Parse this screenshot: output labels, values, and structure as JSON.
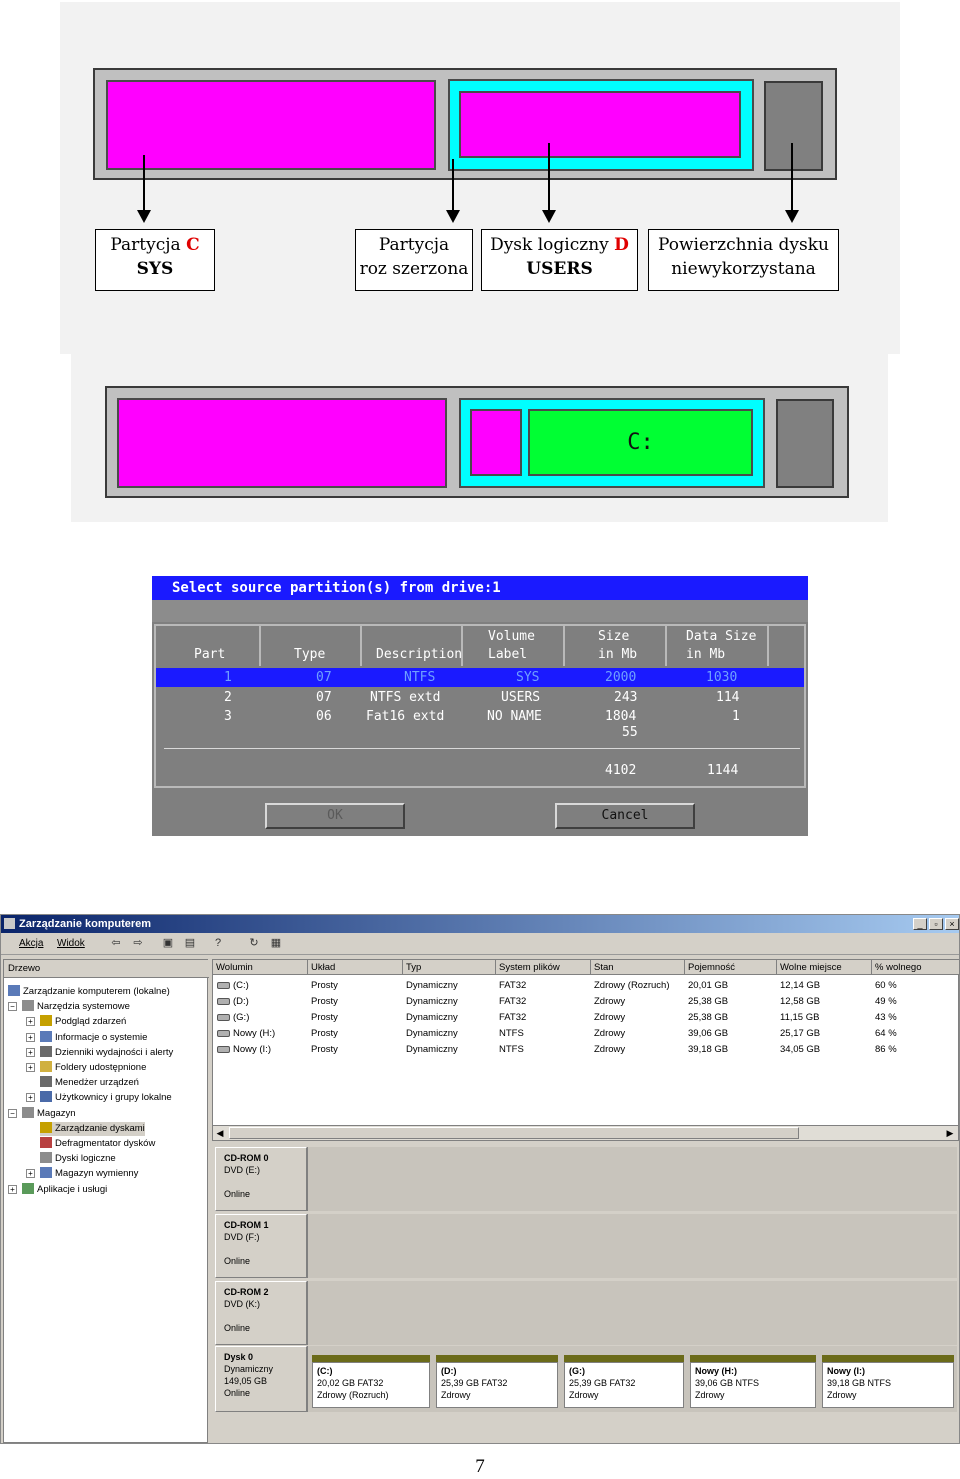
{
  "fig1": {
    "labels": [
      {
        "line1_text": "Partycja ",
        "line1_letter": "C",
        "line2": "SYS"
      },
      {
        "line1": "Partycja",
        "line2": "roz szerzona"
      },
      {
        "line1_text": "Dysk logiczny ",
        "line1_letter": "D",
        "line2": "USERS"
      },
      {
        "line1": "Powierzchnia dysku",
        "line2": "niewykorzystana"
      }
    ],
    "colors": {
      "primary": "#ff00ff",
      "extended": "#00ffff",
      "unused": "#808080",
      "logical": "#00ff33"
    }
  },
  "fig2": {
    "drive_label": "C:"
  },
  "dos": {
    "title": "Select source partition(s) from drive:1",
    "headers": [
      {
        "l1": "",
        "l2": "Part"
      },
      {
        "l1": "",
        "l2": "Type"
      },
      {
        "l1": "",
        "l2": "Description"
      },
      {
        "l1": "Volume",
        "l2": "Label"
      },
      {
        "l1": "Size",
        "l2": "in Mb"
      },
      {
        "l1": "Data Size",
        "l2": "in Mb"
      }
    ],
    "rows": [
      [
        "1",
        "07",
        "NTFS",
        "SYS",
        "2000",
        "1030"
      ],
      [
        "2",
        "07",
        "NTFS extd",
        "USERS",
        "243",
        "114"
      ],
      [
        "3",
        "06",
        "Fat16 extd",
        "NO NAME",
        "1804",
        "1"
      ]
    ],
    "extra_size": "55",
    "total_size": "4102",
    "total_data": "1144",
    "ok": "OK",
    "cancel": "Cancel"
  },
  "win": {
    "title": "Zarządzanie komputerem",
    "controls": [
      "_",
      "▫",
      "×"
    ],
    "menu": [
      "Akcja",
      "Widok"
    ],
    "tree_header": "Drzewo",
    "tree": [
      {
        "label": "Zarządzanie komputerem (lokalne)",
        "level": 0,
        "exp": ""
      },
      {
        "label": "Narzędzia systemowe",
        "level": 1,
        "exp": "−"
      },
      {
        "label": "Podgląd zdarzeń",
        "level": 2,
        "exp": "+"
      },
      {
        "label": "Informacje o systemie",
        "level": 2,
        "exp": "+"
      },
      {
        "label": "Dzienniki wydajności i alerty",
        "level": 2,
        "exp": "+"
      },
      {
        "label": "Foldery udostępnione",
        "level": 2,
        "exp": "+"
      },
      {
        "label": "Menedżer urządzeń",
        "level": 2,
        "exp": ""
      },
      {
        "label": "Użytkownicy i grupy lokalne",
        "level": 2,
        "exp": "+"
      },
      {
        "label": "Magazyn",
        "level": 1,
        "exp": "−"
      },
      {
        "label": "Zarządzanie dyskami",
        "level": 2,
        "exp": ""
      },
      {
        "label": "Defragmentator dysków",
        "level": 2,
        "exp": ""
      },
      {
        "label": "Dyski logiczne",
        "level": 2,
        "exp": ""
      },
      {
        "label": "Magazyn wymienny",
        "level": 2,
        "exp": "+"
      },
      {
        "label": "Aplikacje i usługi",
        "level": 1,
        "exp": "+"
      }
    ],
    "columns": [
      "Wolumin",
      "Układ",
      "Typ",
      "System plików",
      "Stan",
      "Pojemność",
      "Wolne miejsce",
      "% wolnego"
    ],
    "volumes": [
      [
        "(C:)",
        "Prosty",
        "Dynamiczny",
        "FAT32",
        "Zdrowy (Rozruch)",
        "20,01 GB",
        "12,14 GB",
        "60 %"
      ],
      [
        "(D:)",
        "Prosty",
        "Dynamiczny",
        "FAT32",
        "Zdrowy",
        "25,38 GB",
        "12,58 GB",
        "49 %"
      ],
      [
        "(G:)",
        "Prosty",
        "Dynamiczny",
        "FAT32",
        "Zdrowy",
        "25,38 GB",
        "11,15 GB",
        "43 %"
      ],
      [
        "Nowy (H:)",
        "Prosty",
        "Dynamiczny",
        "NTFS",
        "Zdrowy",
        "39,06 GB",
        "25,17 GB",
        "64 %"
      ],
      [
        "Nowy (I:)",
        "Prosty",
        "Dynamiczny",
        "NTFS",
        "Zdrowy",
        "39,18 GB",
        "34,05 GB",
        "86 %"
      ]
    ],
    "disks": [
      {
        "name": "CD-ROM 0",
        "sub": "DVD (E:)",
        "status": "Online"
      },
      {
        "name": "CD-ROM 1",
        "sub": "DVD (F:)",
        "status": "Online"
      },
      {
        "name": "CD-ROM 2",
        "sub": "DVD (K:)",
        "status": "Online"
      }
    ],
    "disk0": {
      "name": "Dysk 0",
      "type": "Dynamiczny",
      "size": "149,05 GB",
      "status": "Online",
      "parts": [
        {
          "name": "(C:)",
          "info": "20,02 GB FAT32",
          "state": "Zdrowy (Rozruch)"
        },
        {
          "name": "(D:)",
          "info": "25,39 GB FAT32",
          "state": "Zdrowy"
        },
        {
          "name": "(G:)",
          "info": "25,39 GB FAT32",
          "state": "Zdrowy"
        },
        {
          "name": "Nowy (H:)",
          "info": "39,06 GB NTFS",
          "state": "Zdrowy"
        },
        {
          "name": "Nowy (I:)",
          "info": "39,18 GB NTFS",
          "state": "Zdrowy"
        }
      ]
    }
  },
  "page_number": "7"
}
